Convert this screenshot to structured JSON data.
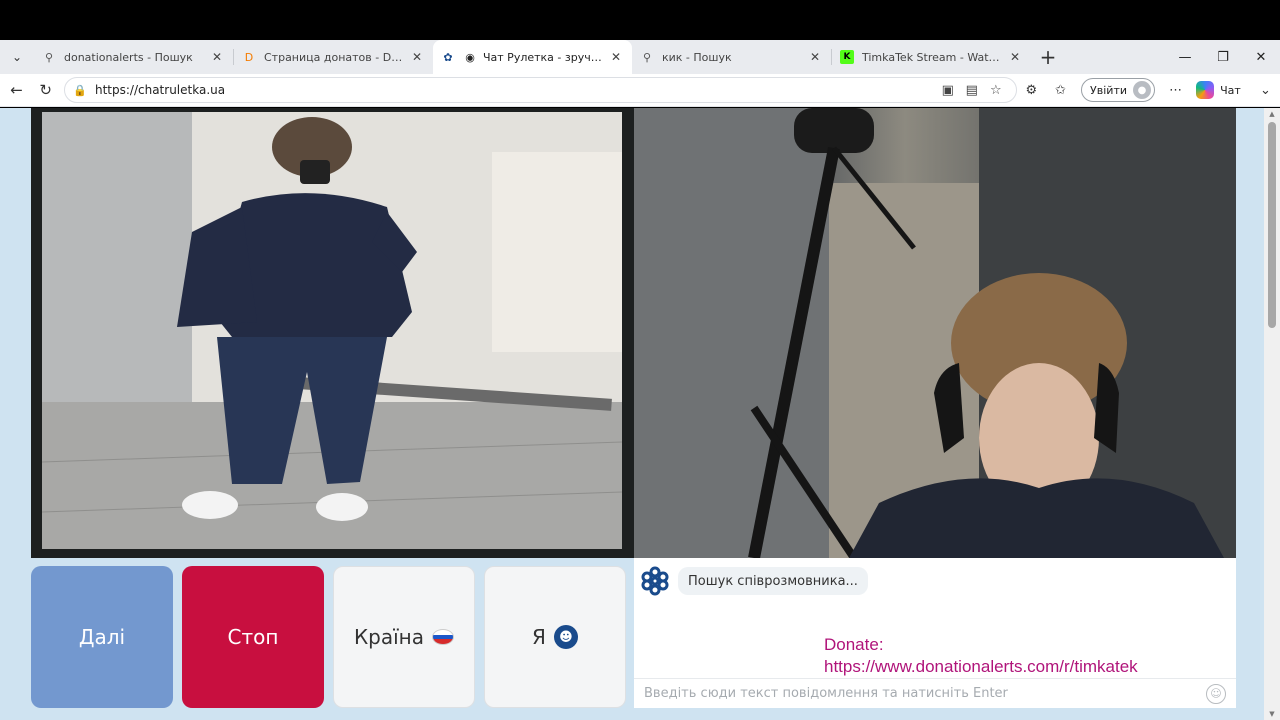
{
  "tabs": [
    {
      "title": "donationalerts - Пошук",
      "icon": "search-icon",
      "active": false
    },
    {
      "title": "Страница донатов - DonationAlerts",
      "icon": "donationalerts-icon",
      "active": false
    },
    {
      "title": "Чат Рулетка - зручний та безпечний",
      "icon": "chatruletka-icon",
      "active": true
    },
    {
      "title": "кик - Пошук",
      "icon": "search-icon",
      "active": false
    },
    {
      "title": "TimkaTek Stream - Watch Live on Kick",
      "icon": "kick-icon",
      "active": false
    }
  ],
  "address": {
    "url": "https://chatruletka.ua",
    "signin_label": "Увійти",
    "copilot_label": "Чат"
  },
  "controls": {
    "next_label": "Далі",
    "stop_label": "Стоп",
    "country_label": "Країна",
    "me_label": "Я"
  },
  "chat": {
    "status_text": "Пошук співрозмовника...",
    "donate_line1": "Donate:",
    "donate_line2": "https://www.donationalerts.com/r/timkatek",
    "input_placeholder": "Введіть сюди текст повідомлення та натисніть Enter"
  },
  "colors": {
    "next_button": "#7398cf",
    "stop_button": "#c80f3f",
    "donate_text": "#b0147a",
    "page_background": "#cfe3f1"
  }
}
